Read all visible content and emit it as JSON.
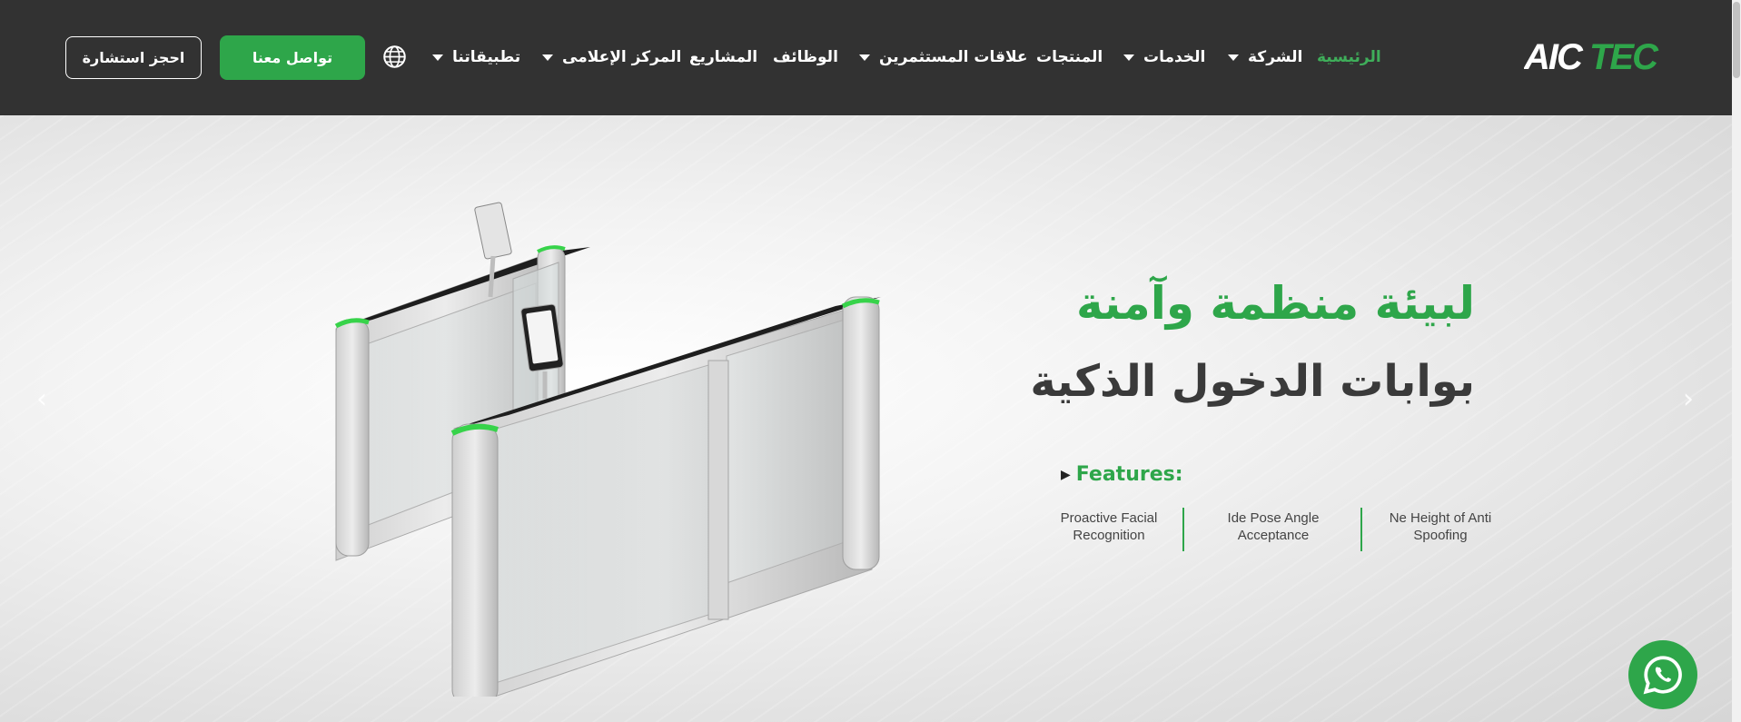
{
  "header": {
    "logo_text": "AICTEC",
    "consult_button": "احجز استشارة",
    "contact_button": "تواصل معنا",
    "globe_icon": "globe-icon",
    "nav": [
      {
        "label": "الرئيسية",
        "active": true,
        "dropdown": false
      },
      {
        "label": "الشركة",
        "active": false,
        "dropdown": true
      },
      {
        "label": "الخدمات",
        "active": false,
        "dropdown": true
      },
      {
        "label": "المنتجات",
        "active": false,
        "dropdown": false
      },
      {
        "label": "علاقات المستثمرين",
        "active": false,
        "dropdown": true
      },
      {
        "label": "الوظائف",
        "active": false,
        "dropdown": false
      },
      {
        "label": "المشاريع",
        "active": false,
        "dropdown": false
      },
      {
        "label": "المركز الإعلامى",
        "active": false,
        "dropdown": true
      },
      {
        "label": "تطبيقاتنا",
        "active": false,
        "dropdown": true
      }
    ]
  },
  "hero": {
    "title_line1": "لبيئة منظمة وآمنة",
    "title_line2": "بوابات الدخول الذكية",
    "features_label": "Features:",
    "features": [
      "Proactive Facial Recognition",
      "Ide Pose Angle Acceptance",
      "Ne Height of Anti Spoofing"
    ],
    "prev_arrow": "‹",
    "next_arrow": "›"
  },
  "colors": {
    "brand_green": "#2ea64a",
    "header_bg": "#323232"
  }
}
